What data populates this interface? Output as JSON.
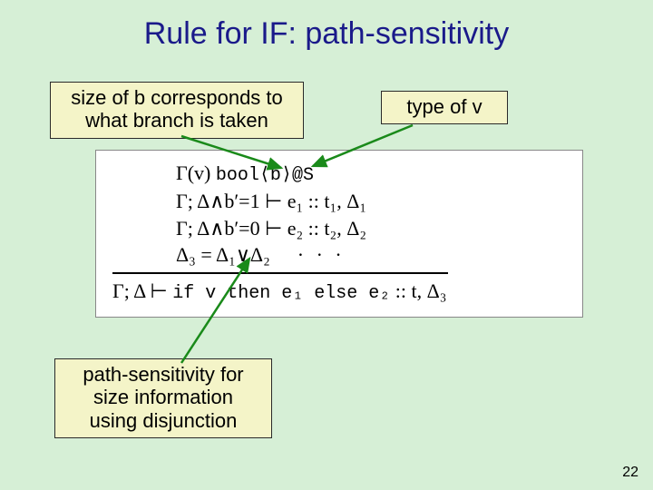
{
  "title": "Rule for IF:  path-sensitivity",
  "callouts": {
    "size_note": "size of b corresponds to what branch is taken",
    "type_note": "type of v",
    "path_note": "path-sensitivity for size information using disjunction"
  },
  "rule": {
    "line1_pre": "Γ(v)   ",
    "line1_tt": "bool⟨b⟩@S",
    "line2": "Γ; Δ∧b′=1 ⊢ e₁ :: t₁, Δ₁",
    "line3": "Γ; Δ∧b′=0 ⊢ e₂ :: t₂, Δ₂",
    "line4_a": "Δ₃ = Δ₁∨Δ₂",
    "line4_dots": "· · ·",
    "concl_pre": "Γ; Δ ⊢ ",
    "concl_tt": "if v then e₁ else e₂",
    "concl_post": " :: t, Δ₃"
  },
  "page_number": "22"
}
